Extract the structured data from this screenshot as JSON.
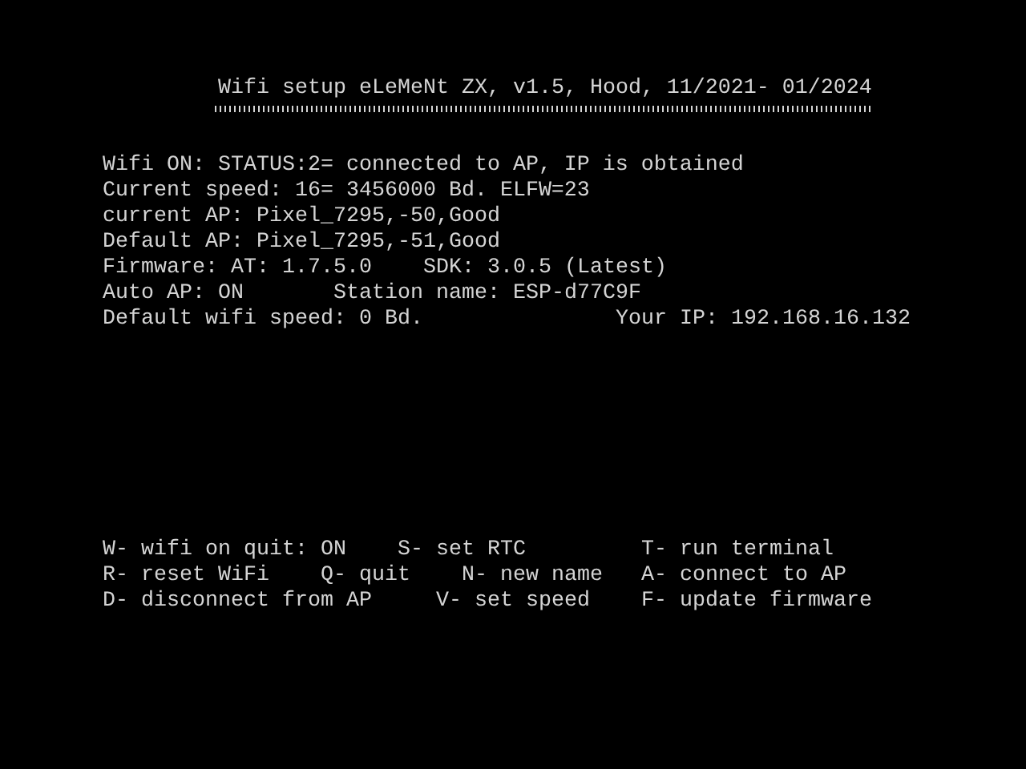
{
  "title": "Wifi setup eLeMeNt ZX, v1.5, Hood, 11/2021- 01/2024",
  "status_lines": [
    [
      {
        "text": "Wifi ON: STATUS:2= connected to AP, IP is obtained"
      }
    ],
    [
      {
        "text": "Current speed: 16= 3456000 Bd. ELFW=23"
      }
    ],
    [
      {
        "text": "current AP: Pixel_7295,-50,Good"
      }
    ],
    [
      {
        "text": "Default AP: Pixel_7295,-51,Good"
      }
    ],
    [
      {
        "text": "Firmware: AT: 1.7.5.0"
      },
      {
        "text": "SDK: 3.0.5 (Latest)"
      }
    ],
    [
      {
        "text": "Auto AP: ON"
      },
      {
        "text": "Station name: ESP-d77C9F"
      }
    ],
    [
      {
        "text": "Default wifi speed: 0 Bd."
      },
      {
        "text": "Your IP: 192.168.16.132"
      }
    ]
  ],
  "menu_rows": [
    [
      {
        "text": "W- wifi on quit: ON"
      },
      {
        "text": "S- set RTC"
      },
      {
        "text": "T- run terminal"
      }
    ],
    [
      {
        "text": "R- reset WiFi"
      },
      {
        "text": "Q- quit"
      },
      {
        "text": "N- new name"
      },
      {
        "text": "A- connect to AP"
      }
    ],
    [
      {
        "text": "D- disconnect from AP"
      },
      {
        "text": "V- set speed"
      },
      {
        "text": "F- update firmware"
      }
    ]
  ]
}
